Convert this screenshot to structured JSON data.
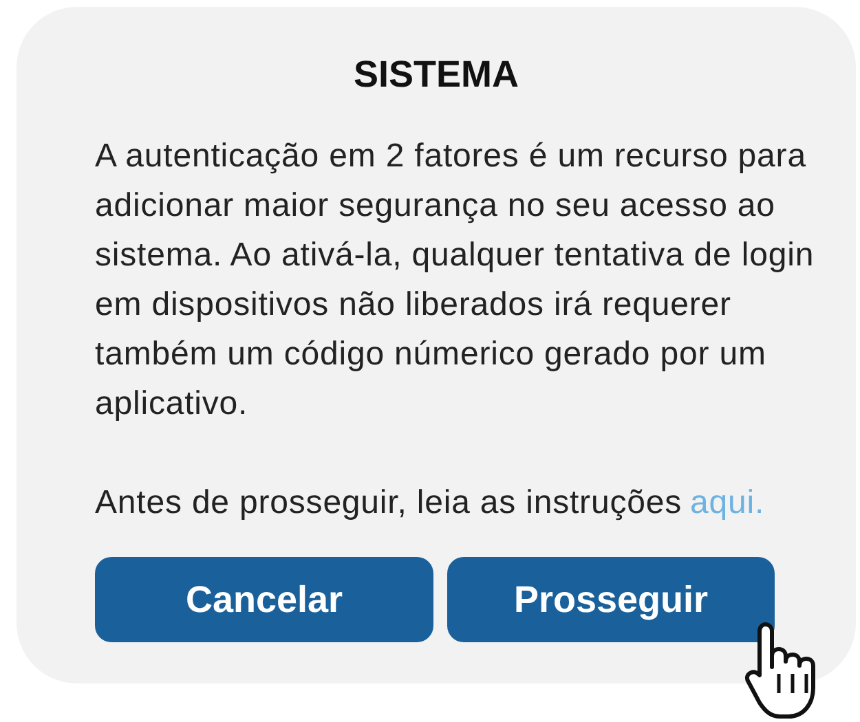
{
  "dialog": {
    "title": "SISTEMA",
    "message": "A autenticação em 2 fatores é um recurso para adicionar maior segurança no seu acesso ao sistema. Ao ativá-la, qualquer tentativa de login em dispositivos não liberados irá requerer também um código númerico gerado por um aplicativo.",
    "instructions": "Antes de prosseguir, leia as instruções",
    "link": "aqui.",
    "buttons": [
      {
        "label": "Cancelar"
      },
      {
        "label": "Prosseguir"
      }
    ]
  }
}
